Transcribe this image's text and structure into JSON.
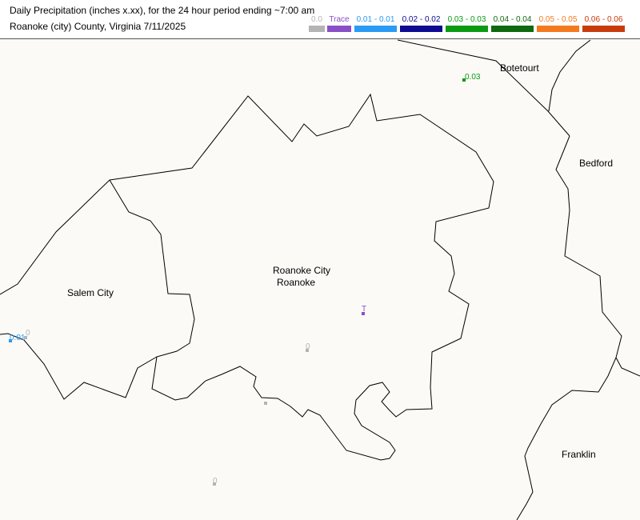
{
  "header": {
    "title_line1": "Daily Precipitation (inches  x.xx),  for the 24 hour period ending ~7:00 am",
    "title_line2": "Roanoke (city) County, Virginia  7/11/2025"
  },
  "legend": [
    {
      "label": "0.0",
      "color": "#b4b4b4"
    },
    {
      "label": "Trace",
      "color": "#8a4fc8"
    },
    {
      "label": "0.01 - 0.01",
      "color": "#2a9bf4"
    },
    {
      "label": "0.02 - 0.02",
      "color": "#0e0b92"
    },
    {
      "label": "0.03 - 0.03",
      "color": "#0a9b12"
    },
    {
      "label": "0.04 - 0.04",
      "color": "#0d6a0e"
    },
    {
      "label": "0.05 - 0.05",
      "color": "#f57a1e"
    },
    {
      "label": "0.06 - 0.06",
      "color": "#c83c0c"
    }
  ],
  "map": {
    "places": {
      "botetourt": "Botetourt",
      "bedford": "Bedford",
      "salem": "Salem City",
      "roanoke_city": "Roanoke City",
      "roanoke": "Roanoke",
      "franklin": "Franklin"
    },
    "stations": [
      {
        "id": "stn-botetourt",
        "value": "0.03",
        "color": "#0a9b12"
      },
      {
        "id": "stn-roanoke-t",
        "value": "T",
        "color": "#8a4fc8"
      },
      {
        "id": "stn-roanoke-0a",
        "value": "0",
        "color": "#b4b4b4"
      },
      {
        "id": "stn-roanoke-0b",
        "value": "",
        "color": "#b4b4b4"
      },
      {
        "id": "stn-south-0",
        "value": "0",
        "color": "#b4b4b4"
      },
      {
        "id": "stn-west-0",
        "value": "0",
        "color": "#b4b4b4"
      },
      {
        "id": "stn-west-001",
        "value": "0.01",
        "color": "#2a9bf4"
      }
    ]
  }
}
